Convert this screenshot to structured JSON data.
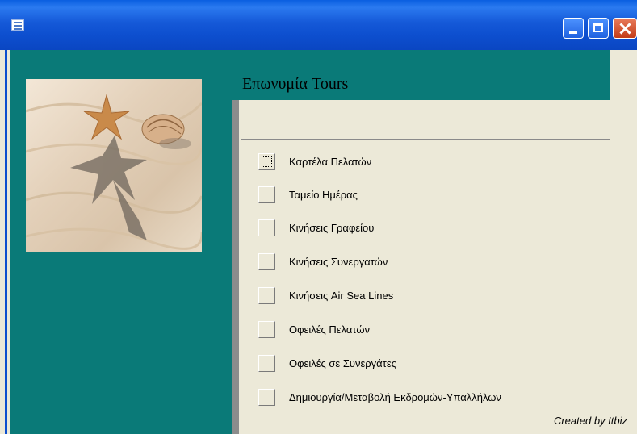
{
  "window": {
    "title": "",
    "icon": "form-icon",
    "controls": [
      "minimize",
      "maximize",
      "close"
    ]
  },
  "header": {
    "title": "Επωνυμία Tours"
  },
  "picture": {
    "description_icon": "beach-starfish-shell-image"
  },
  "menu": {
    "items": [
      {
        "label": "Καρτέλα Πελατών"
      },
      {
        "label": "Ταμείο Ημέρας"
      },
      {
        "label": "Κινήσεις Γραφείου"
      },
      {
        "label": "Κινήσεις Συνεργατών"
      },
      {
        "label": "Κινήσεις Air Sea Lines"
      },
      {
        "label": "Οφειλές Πελατών"
      },
      {
        "label": "Οφειλές σε Συνεργάτες"
      },
      {
        "label": "Δημιουργία/Μεταβολή Εκδρομών-Υπαλλήλων"
      }
    ]
  },
  "footer": {
    "credit": "Created by Itbiz"
  },
  "colors": {
    "teal": "#0a7a78",
    "titlebar": "#0d4fcf",
    "background": "#ece9d8"
  }
}
